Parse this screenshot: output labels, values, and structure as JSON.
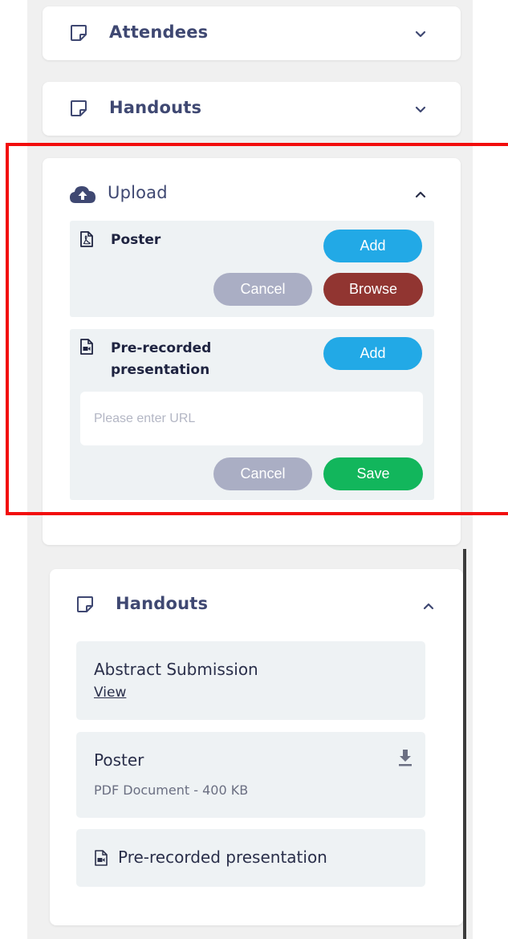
{
  "accordions": {
    "attendees": {
      "title": "Attendees"
    },
    "handouts_top": {
      "title": "Handouts"
    },
    "upload": {
      "title": "Upload",
      "poster": {
        "label": "Poster",
        "add_label": "Add",
        "cancel_label": "Cancel",
        "browse_label": "Browse"
      },
      "prerecorded": {
        "label_line1": "Pre-recorded",
        "label_line2": "presentation",
        "add_label": "Add",
        "url_placeholder": "Please enter URL",
        "cancel_label": "Cancel",
        "save_label": "Save"
      }
    },
    "handouts": {
      "title": "Handouts",
      "items": [
        {
          "title": "Abstract Submission",
          "link": "View"
        },
        {
          "title": "Poster",
          "meta": "PDF Document - 400 KB"
        },
        {
          "title": "Pre-recorded presentation"
        }
      ]
    }
  },
  "colors": {
    "add": "#22a9e6",
    "cancel": "#aaaec4",
    "browse": "#913531",
    "save": "#12b65c",
    "highlight": "#f20d0d"
  }
}
